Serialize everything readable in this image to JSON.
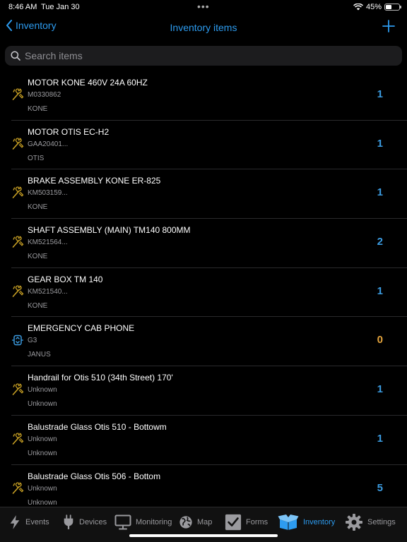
{
  "status": {
    "time": "8:46 AM",
    "date": "Tue Jan 30",
    "dots": "•••",
    "battery": "45%",
    "battery_level": 0.45
  },
  "nav": {
    "back_label": "Inventory",
    "title": "Inventory items"
  },
  "search": {
    "placeholder": "Search items"
  },
  "colors": {
    "accent": "#2d9cf0",
    "qty": "#3b9be0",
    "zero_qty": "#e3a33c",
    "wrench": "#c8a024"
  },
  "items": [
    {
      "name": "MOTOR KONE 460V 24A 60HZ",
      "code": "M0330862",
      "maker": "KONE",
      "qty": "1",
      "icon": "wrench-icon"
    },
    {
      "name": "MOTOR OTIS EC-H2",
      "code": "GAA20401...",
      "maker": "OTIS",
      "qty": "1",
      "icon": "wrench-icon"
    },
    {
      "name": "BRAKE ASSEMBLY KONE  ER-825",
      "code": "KM503159...",
      "maker": "KONE",
      "qty": "1",
      "icon": "wrench-icon"
    },
    {
      "name": "SHAFT ASSEMBLY (MAIN) TM140 800MM",
      "code": "KM521564...",
      "maker": "KONE",
      "qty": "2",
      "icon": "wrench-icon"
    },
    {
      "name": "GEAR BOX TM 140",
      "code": "KM521540...",
      "maker": "KONE",
      "qty": "1",
      "icon": "wrench-icon"
    },
    {
      "name": "EMERGENCY CAB PHONE",
      "code": "G3",
      "maker": "JANUS",
      "qty": "0",
      "icon": "elevator-icon"
    },
    {
      "name": "Handrail for  Otis 510 (34th Street) 170'",
      "code": "Unknown",
      "maker": "Unknown",
      "qty": "1",
      "icon": "wrench-icon"
    },
    {
      "name": "Balustrade Glass Otis 510 - Bottowm",
      "code": "Unknown",
      "maker": "Unknown",
      "qty": "1",
      "icon": "wrench-icon"
    },
    {
      "name": "Balustrade Glass Otis 506 - Bottom",
      "code": "Unknown",
      "maker": "Unknown",
      "qty": "5",
      "icon": "wrench-icon"
    }
  ],
  "tabs": [
    {
      "label": "Events",
      "icon": "bolt-icon"
    },
    {
      "label": "Devices",
      "icon": "plug-icon"
    },
    {
      "label": "Monitoring",
      "icon": "monitor-icon"
    },
    {
      "label": "Map",
      "icon": "globe-icon"
    },
    {
      "label": "Forms",
      "icon": "checkbox-icon"
    },
    {
      "label": "Inventory",
      "icon": "box-icon"
    },
    {
      "label": "Settings",
      "icon": "gear-icon"
    }
  ]
}
